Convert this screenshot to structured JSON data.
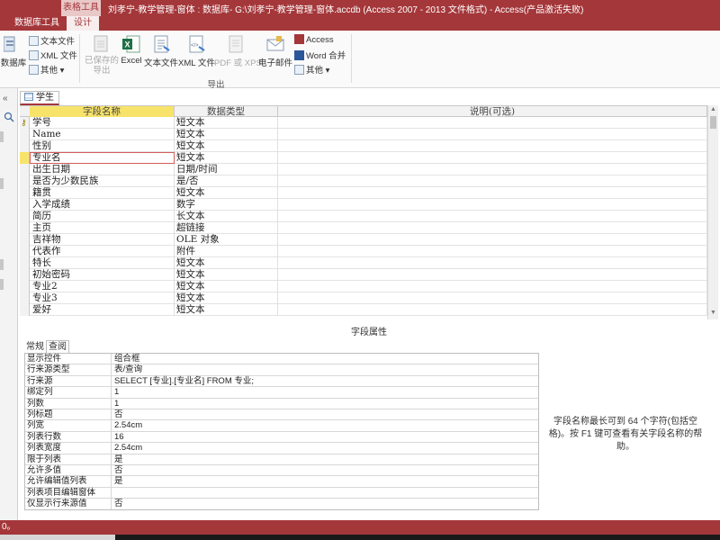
{
  "titlebar": {
    "context_tab": "表格工具",
    "title": "刘孝宁-教学管理-窗体 : 数据库- G:\\刘孝宁-教学管理-窗体.accdb (Access 2007 - 2013 文件格式) -   Access(产品激活失败)"
  },
  "tabs": {
    "db_tools": "数据库工具",
    "design": "设计"
  },
  "ribbon": {
    "left_partial": "数据库",
    "text_file_small": "文本文件",
    "xml_file_small": "XML 文件",
    "other_small": "其他",
    "saved_exports_line1": "已保存的",
    "saved_exports_line2": "导出",
    "excel": "Excel",
    "text_file": "文本文件",
    "xml_file": "XML 文件",
    "pdf_xps": "PDF 或 XPS",
    "email": "电子邮件",
    "access": "Access",
    "word_merge": "Word 合并",
    "other": "其他",
    "group_export": "导出"
  },
  "nav": {
    "collapse": "«",
    "search_icon": "search-icon"
  },
  "doc_tab": {
    "label": "学生"
  },
  "grid": {
    "headers": [
      "字段名称",
      "数据类型",
      "说明(可选)"
    ],
    "rows": [
      {
        "name": "学号",
        "type": "短文本"
      },
      {
        "name": "Name",
        "type": "短文本"
      },
      {
        "name": "性别",
        "type": "短文本"
      },
      {
        "name": "专业名",
        "type": "短文本"
      },
      {
        "name": "出生日期",
        "type": "日期/时间"
      },
      {
        "name": "是否为少数民族",
        "type": "是/否"
      },
      {
        "name": "籍贯",
        "type": "短文本"
      },
      {
        "name": "入学成绩",
        "type": "数字"
      },
      {
        "name": "简历",
        "type": "长文本"
      },
      {
        "name": "主页",
        "type": "超链接"
      },
      {
        "name": "吉祥物",
        "type": "OLE 对象"
      },
      {
        "name": "代表作",
        "type": "附件"
      },
      {
        "name": "特长",
        "type": "短文本"
      },
      {
        "name": "初始密码",
        "type": "短文本"
      },
      {
        "name": "专业2",
        "type": "短文本"
      },
      {
        "name": "专业3",
        "type": "短文本"
      },
      {
        "name": "爱好",
        "type": "短文本"
      }
    ]
  },
  "field_properties": {
    "label": "字段属性",
    "tabs": [
      "常规",
      "查阅"
    ],
    "rows": [
      {
        "name": "显示控件",
        "value": "组合框"
      },
      {
        "name": "行来源类型",
        "value": "表/查询"
      },
      {
        "name": "行来源",
        "value": "SELECT [专业].[专业名] FROM 专业;"
      },
      {
        "name": "绑定列",
        "value": "1"
      },
      {
        "name": "列数",
        "value": "1"
      },
      {
        "name": "列标题",
        "value": "否"
      },
      {
        "name": "列宽",
        "value": "2.54cm"
      },
      {
        "name": "列表行数",
        "value": "16"
      },
      {
        "name": "列表宽度",
        "value": "2.54cm"
      },
      {
        "name": "限于列表",
        "value": "是"
      },
      {
        "name": "允许多值",
        "value": "否"
      },
      {
        "name": "允许编辑值列表",
        "value": "是"
      },
      {
        "name": "列表项目编辑窗体",
        "value": ""
      },
      {
        "name": "仅显示行来源值",
        "value": "否"
      }
    ],
    "help_text": "字段名称最长可到 64 个字符(包括空格)。按 F1 键可查看有关字段名称的帮助。"
  },
  "statusbar": {
    "text": "0。"
  },
  "colors": {
    "accent": "#a4373a",
    "highlight": "#f7e36a"
  }
}
